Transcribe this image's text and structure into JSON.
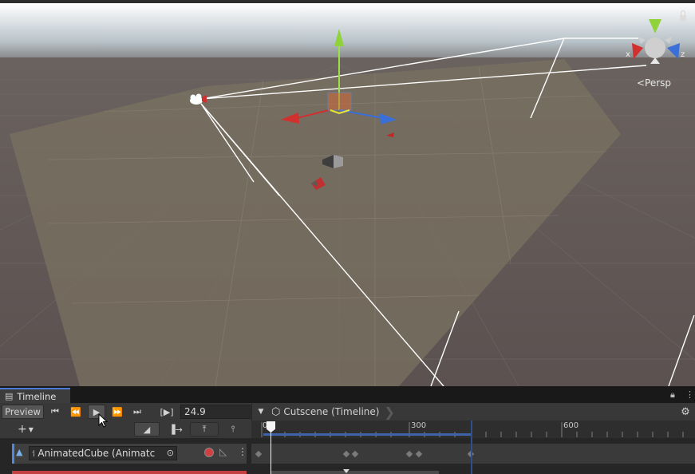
{
  "scene": {
    "view_label": "<Persp",
    "axis_labels": {
      "x": "x",
      "y": "y",
      "z": "z"
    }
  },
  "timeline": {
    "tab_title": "Timeline",
    "toolbar": {
      "preview_label": "Preview",
      "frame_value": "24.9",
      "breadcrumb": "Cutscene (Timeline)"
    },
    "ruler": {
      "labels": [
        "0",
        "300",
        "600"
      ]
    },
    "track": {
      "name": "AnimatedCube (Animatc"
    }
  },
  "colors": {
    "accent": "#4b7bd6",
    "record": "#d04040",
    "gizmo_x": "#d22f2f",
    "gizmo_y": "#8fd23a",
    "gizmo_z": "#3a6fd8"
  }
}
